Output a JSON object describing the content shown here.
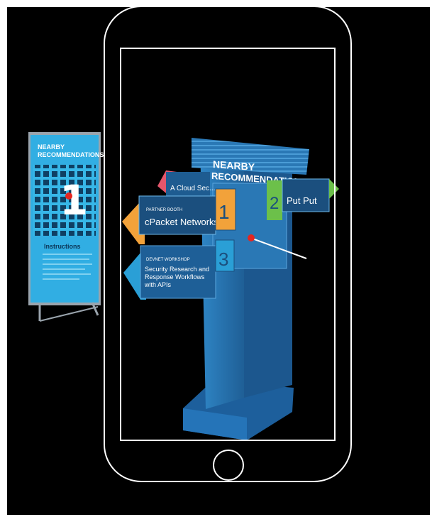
{
  "banner": {
    "title_line1": "NEARBY",
    "title_line2": "RECOMMENDATIONS",
    "big_number": "1",
    "instructions_heading": "Instructions"
  },
  "signpost": {
    "header_line1": "NEARBY",
    "header_line2": "RECOMMENDATIONS",
    "arrows": [
      {
        "number": "",
        "category": "",
        "title": "A Cloud Sec...",
        "color": "#e3566b"
      },
      {
        "number": "1",
        "category": "PARTNER BOOTH",
        "title": "cPacket Networks",
        "color": "#f2a23a"
      },
      {
        "number": "3",
        "category": "DEVNET WORKSHOP",
        "title": "Security Research and Response Workflows with APIs",
        "color": "#2a9fd6"
      },
      {
        "number": "2",
        "category": "",
        "title": "Put Put",
        "color": "#6cc04a"
      }
    ]
  },
  "phone": {
    "frame_color": "#ffffff"
  }
}
